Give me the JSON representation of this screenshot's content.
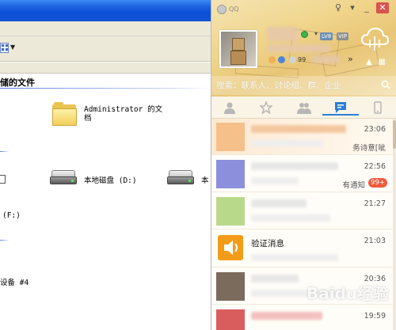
{
  "explorer": {
    "section_title": "储的文件",
    "folder_label_line1": "Administrator 的文",
    "folder_label_line2": "档",
    "drive_d_label": "本地磁盘 (D:)",
    "drive_e_label_partial": "本",
    "drive_f_fragment": "(F:)",
    "device_fragment": "设备 #4"
  },
  "qq": {
    "brand": "QQ",
    "level_badge": "LV8",
    "vip_badge": "VIP",
    "mail_count": "99",
    "more_symbol": "»",
    "search_placeholder": "搜索：联系人、讨论组、群、企业",
    "chats": [
      {
        "time": "23:06",
        "preview": "务诗意[呲",
        "color": "#f6c08a"
      },
      {
        "time": "22:56",
        "preview": "有通知",
        "unread": "99+",
        "color": "#8b8fdc"
      },
      {
        "time": "21:27",
        "preview": "",
        "color": "#b9d98a"
      },
      {
        "time": "21:03",
        "title": "验证消息",
        "color": "#f39c1a"
      },
      {
        "time": "20:36",
        "preview": "",
        "color": "#7a6b5c"
      },
      {
        "time": "19:59",
        "preview": "",
        "color": "#d95d5d"
      }
    ],
    "watermark": "Baidu经验"
  },
  "colors": {
    "qq_header": "#f0d58c",
    "accent_blue": "#2a7fd5",
    "unread_red": "#ee5a3a",
    "online_green": "#3fb24a"
  }
}
